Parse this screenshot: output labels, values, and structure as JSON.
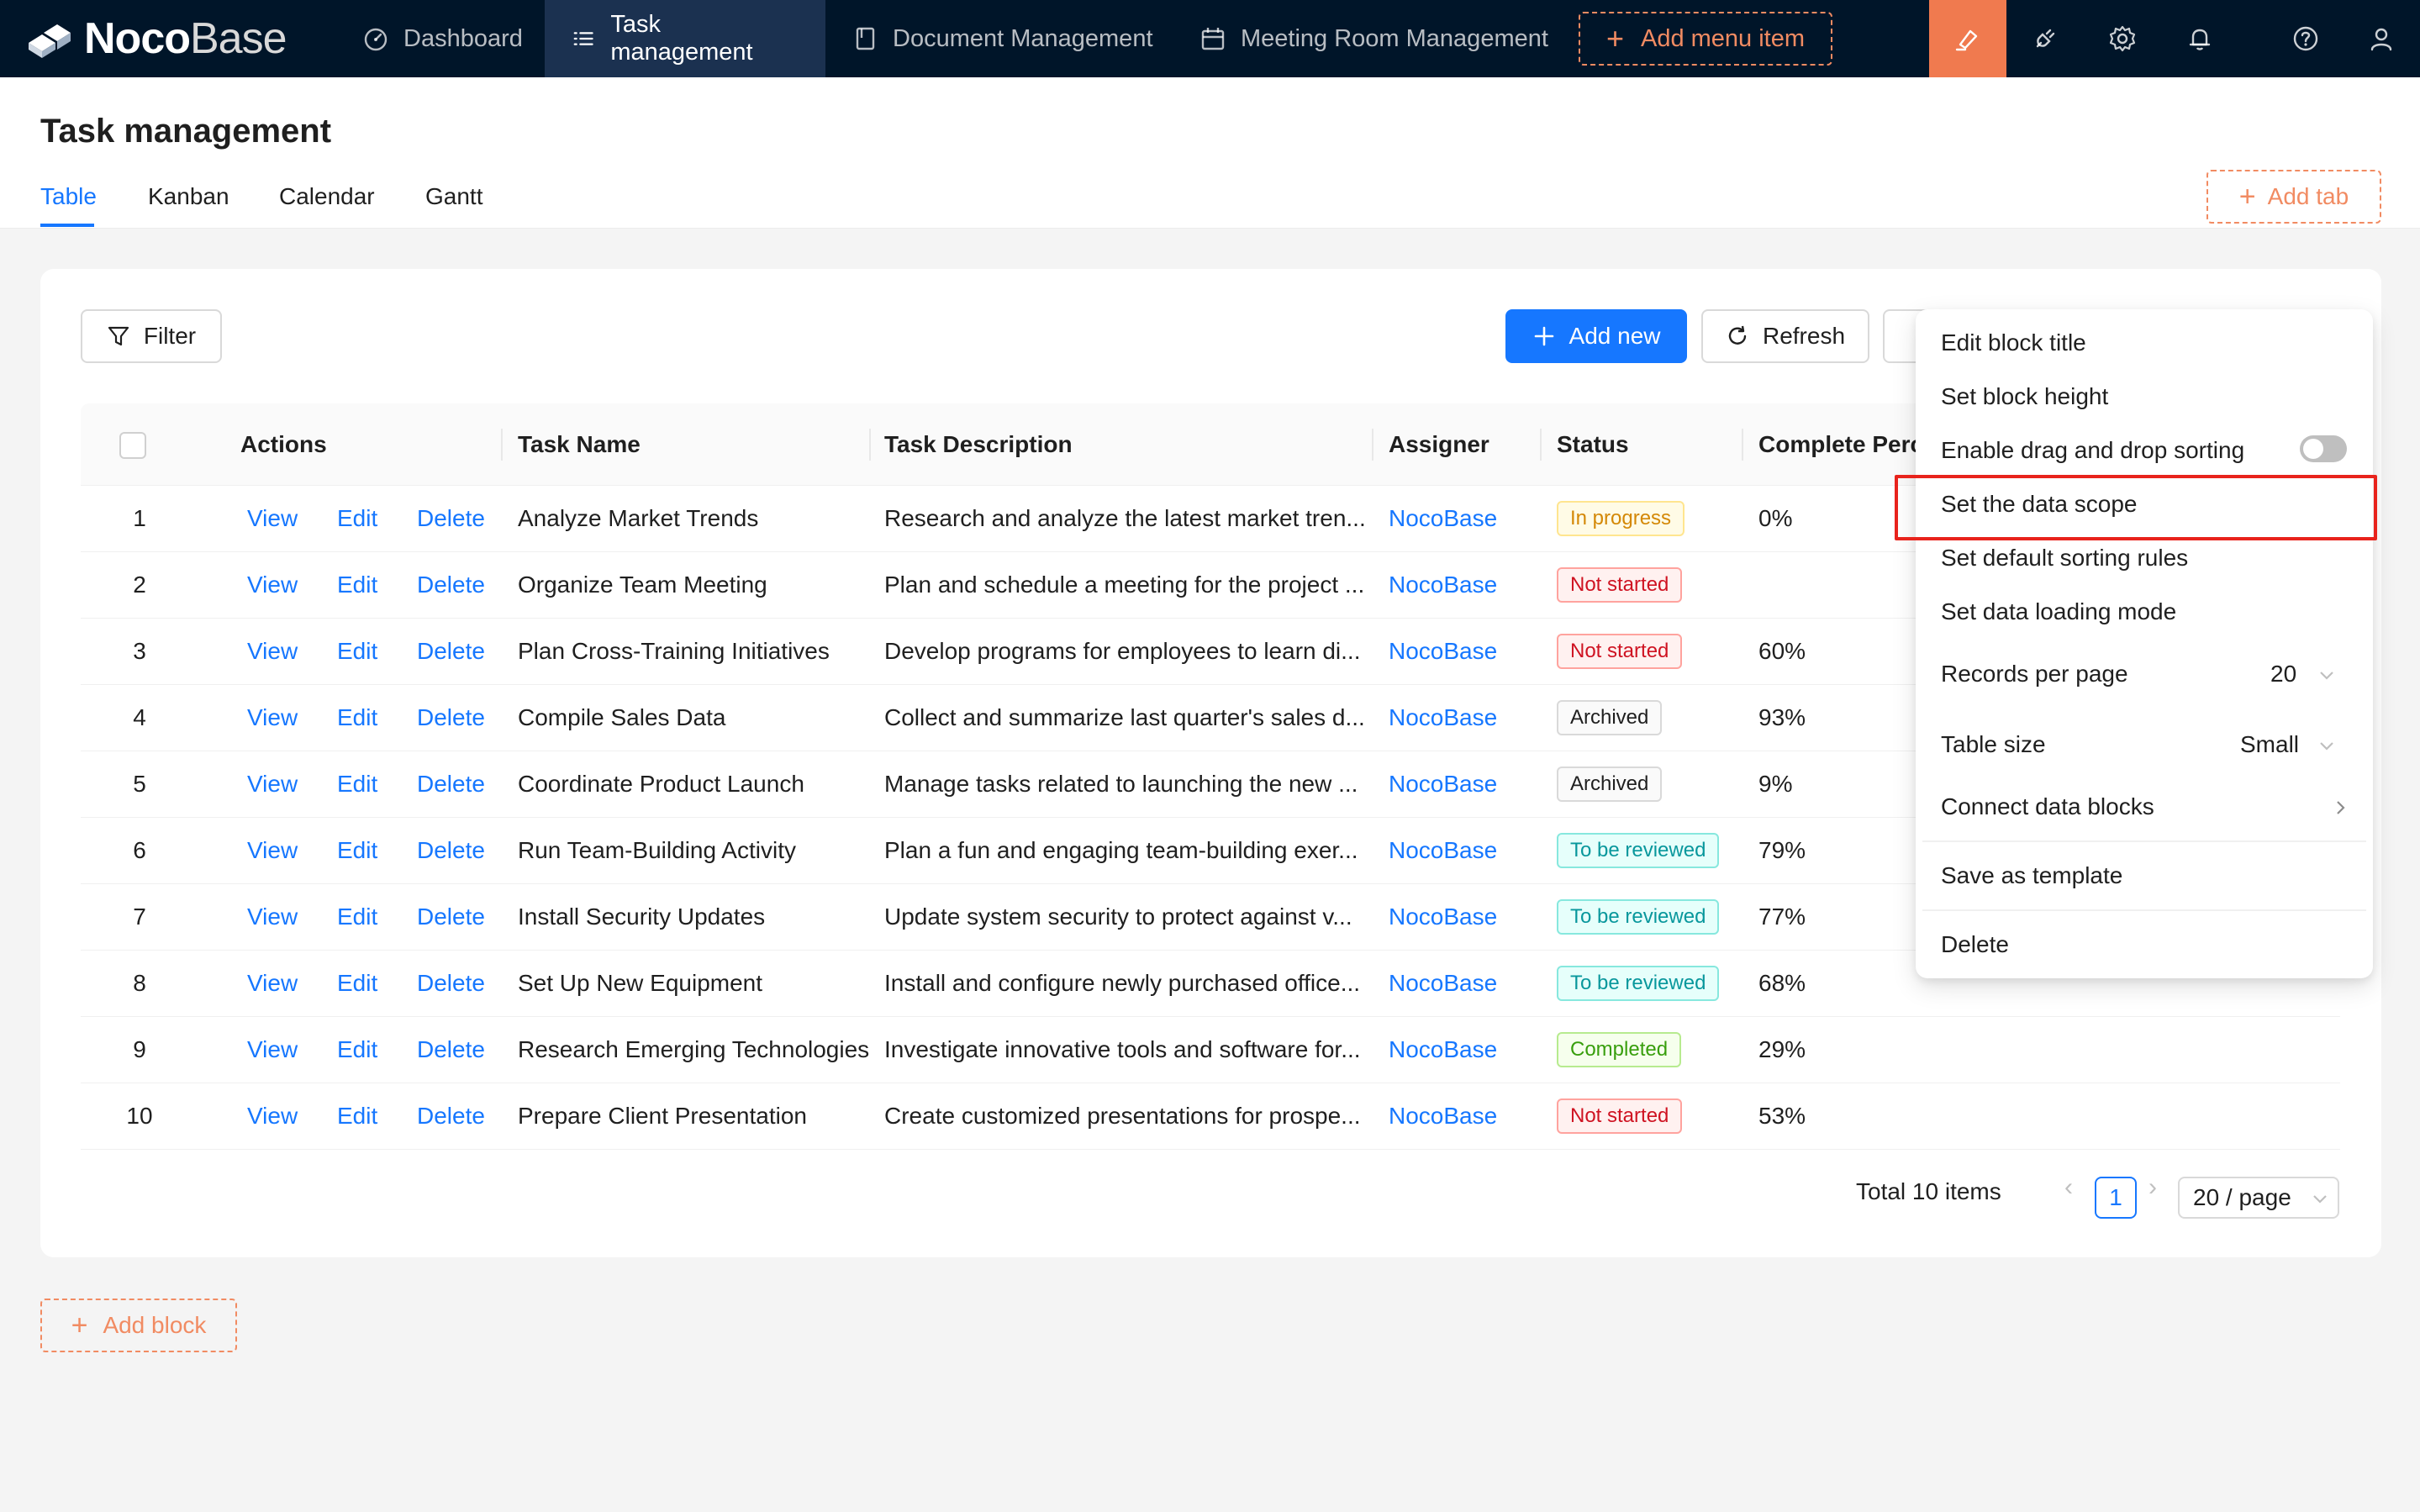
{
  "app": {
    "brand_part1": "Noco",
    "brand_part2": "Base",
    "nav": [
      {
        "label": "Dashboard",
        "icon": "dashboard-icon"
      },
      {
        "label": "Task management",
        "icon": "list-icon"
      },
      {
        "label": "Document Management",
        "icon": "book-icon"
      },
      {
        "label": "Meeting Room Management",
        "icon": "calendar-icon"
      }
    ],
    "add_menu_item": "Add menu item",
    "accent": "#f07a4f",
    "nav_bg": "#001529"
  },
  "page": {
    "title": "Task management",
    "tabs": [
      "Table",
      "Kanban",
      "Calendar",
      "Gantt"
    ],
    "active_tab": "Table",
    "add_tab": "Add tab",
    "add_block": "Add block"
  },
  "toolbar": {
    "filter": "Filter",
    "add_new": "Add new",
    "refresh": "Refresh"
  },
  "table": {
    "columns": [
      "Actions",
      "Task Name",
      "Task Description",
      "Assigner",
      "Status",
      "Complete Percent"
    ],
    "action_labels": {
      "view": "View",
      "edit": "Edit",
      "delete": "Delete"
    },
    "rows": [
      {
        "no": "1",
        "name": "Analyze Market Trends",
        "desc": "Research and analyze the latest market tren...",
        "assigner": "NocoBase",
        "status": "In progress",
        "pct": "0%"
      },
      {
        "no": "2",
        "name": "Organize Team Meeting",
        "desc": "Plan and schedule a meeting for the project ...",
        "assigner": "NocoBase",
        "status": "Not started",
        "pct": ""
      },
      {
        "no": "3",
        "name": "Plan Cross-Training Initiatives",
        "desc": "Develop programs for employees to learn di...",
        "assigner": "NocoBase",
        "status": "Not started",
        "pct": "60%"
      },
      {
        "no": "4",
        "name": "Compile Sales Data",
        "desc": "Collect and summarize last quarter's sales d...",
        "assigner": "NocoBase",
        "status": "Archived",
        "pct": "93%"
      },
      {
        "no": "5",
        "name": "Coordinate Product Launch",
        "desc": "Manage tasks related to launching the new ...",
        "assigner": "NocoBase",
        "status": "Archived",
        "pct": "9%"
      },
      {
        "no": "6",
        "name": "Run Team-Building Activity",
        "desc": "Plan a fun and engaging team-building exer...",
        "assigner": "NocoBase",
        "status": "To be reviewed",
        "pct": "79%"
      },
      {
        "no": "7",
        "name": "Install Security Updates",
        "desc": "Update system security to protect against v...",
        "assigner": "NocoBase",
        "status": "To be reviewed",
        "pct": "77%"
      },
      {
        "no": "8",
        "name": "Set Up New Equipment",
        "desc": "Install and configure newly purchased office...",
        "assigner": "NocoBase",
        "status": "To be reviewed",
        "pct": "68%"
      },
      {
        "no": "9",
        "name": "Research Emerging Technologies",
        "desc": "Investigate innovative tools and software for...",
        "assigner": "NocoBase",
        "status": "Completed",
        "pct": "29%"
      },
      {
        "no": "10",
        "name": "Prepare Client Presentation",
        "desc": "Create customized presentations for prospe...",
        "assigner": "NocoBase",
        "status": "Not started",
        "pct": "53%"
      }
    ]
  },
  "pagination": {
    "total": "Total 10 items",
    "current": "1",
    "page_size": "20 / page"
  },
  "menu": {
    "items": {
      "edit_title": "Edit block title",
      "set_height": "Set block height",
      "drag_sort": "Enable drag and drop sorting",
      "data_scope": "Set the data scope",
      "sort_rules": "Set default sorting rules",
      "loading_mode": "Set data loading mode",
      "records_per_page": "Records per page",
      "records_value": "20",
      "table_size": "Table size",
      "table_size_value": "Small",
      "connect_blocks": "Connect data blocks",
      "save_template": "Save as template",
      "delete": "Delete"
    },
    "drag_sort_enabled": false,
    "highlighted": "Set the data scope"
  }
}
